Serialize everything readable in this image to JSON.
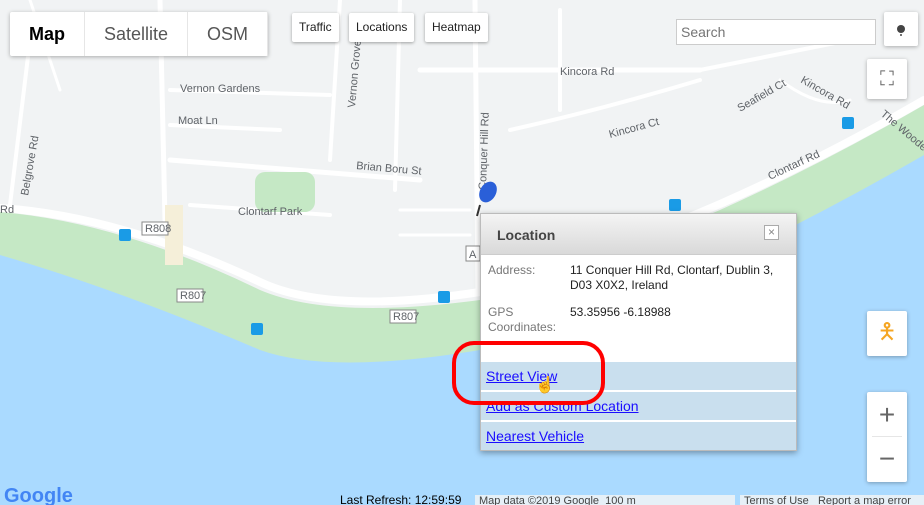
{
  "map_types": [
    {
      "label": "Map",
      "active": true
    },
    {
      "label": "Satellite",
      "active": false
    },
    {
      "label": "OSM",
      "active": false
    }
  ],
  "toggles": {
    "traffic": "Traffic",
    "locations": "Locations",
    "heatmap": "Heatmap"
  },
  "search": {
    "placeholder": "Search",
    "value": ""
  },
  "map_labels": {
    "vernon_gardens": "Vernon Gardens",
    "moat_ln": "Moat Ln",
    "brian_boru": "Brian Boru St",
    "clontarf_park": "Clontarf Park",
    "belgrove": "Belgrove Rd",
    "vernon_grove": "Vernon Grove",
    "conquer_hill": "Conquer Hill Rd",
    "kincora_rd": "Kincora Rd",
    "kincora_rd2": "Kincora Rd",
    "kincora_ct": "Kincora Ct",
    "seafield_ct": "Seafield Ct",
    "clontarf_rd": "Clontarf Rd",
    "wooden": "The Wooden",
    "rd_left": "Rd",
    "r808": "R808",
    "r807a": "R807",
    "r807b": "R807",
    "a_marker": "A"
  },
  "popup": {
    "title": "Location",
    "close": "×",
    "address_label": "Address:",
    "address_value": "11 Conquer Hill Rd, Clontarf, Dublin 3, D03 X0X2, Ireland",
    "gps_label": "GPS Coordinates:",
    "gps_value": "53.35956 -6.18988",
    "links": [
      "Street View",
      "Add as Custom Location",
      "Nearest Vehicle"
    ]
  },
  "controls": {
    "zoom_in": "+",
    "zoom_out": "−"
  },
  "footer": {
    "logo": "Google",
    "last_refresh": "Last Refresh: 12:59:59",
    "map_data": "Map data ©2019 Google",
    "scale": "100 m",
    "terms": "Terms of Use",
    "report": "Report a map error"
  },
  "colors": {
    "water": "#aadaff",
    "park": "#c5e8c5",
    "road": "#ffffff",
    "land": "#f2f2f2",
    "highlight": "#ff0000",
    "link": "#1a0dff"
  }
}
